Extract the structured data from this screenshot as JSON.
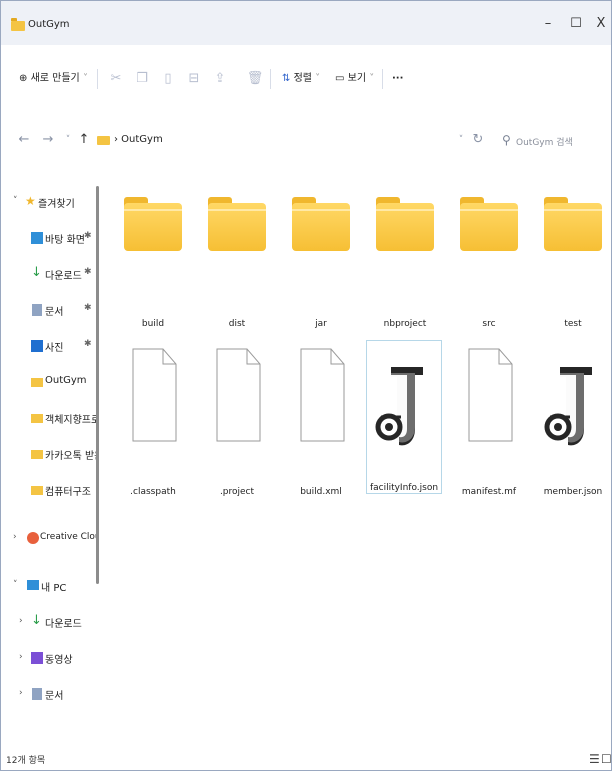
{
  "window": {
    "title": "OutGym",
    "minimize_glyph": "–",
    "maximize_glyph": "☐",
    "close_glyph": "X"
  },
  "toolbar": {
    "new_label": "새로 만들기",
    "sort_label": "정렬",
    "view_label": "보기",
    "more_label": "···",
    "icons": [
      "cut-icon",
      "copy-icon",
      "paste-icon",
      "rename-icon",
      "share-icon",
      "delete-icon"
    ]
  },
  "address": {
    "path": "› OutGym",
    "search_placeholder": "OutGym 검색"
  },
  "sidebar": {
    "items": [
      {
        "label": "즐겨찾기",
        "icon": "star-icon"
      },
      {
        "label": "바탕 화면",
        "icon": "desktop-icon"
      },
      {
        "label": "다운로드",
        "icon": "download-icon"
      },
      {
        "label": "문서",
        "icon": "document-icon"
      },
      {
        "label": "사진",
        "icon": "pictures-icon"
      },
      {
        "label": "OutGym",
        "icon": "folder-icon"
      },
      {
        "label": "객체지향프로그",
        "icon": "folder-icon"
      },
      {
        "label": "카카오톡 받은",
        "icon": "folder-icon"
      },
      {
        "label": "컴퓨터구조",
        "icon": "folder-icon"
      },
      {
        "label": "Creative Cloud F",
        "icon": "creative-cloud-icon"
      },
      {
        "label": "내 PC",
        "icon": "pc-icon"
      },
      {
        "label": "다운로드",
        "icon": "download-icon"
      },
      {
        "label": "동영상",
        "icon": "video-icon"
      },
      {
        "label": "문서",
        "icon": "document-icon"
      }
    ]
  },
  "files": [
    {
      "name": "build",
      "type": "folder"
    },
    {
      "name": "dist",
      "type": "folder"
    },
    {
      "name": "jar",
      "type": "folder"
    },
    {
      "name": "nbproject",
      "type": "folder"
    },
    {
      "name": "src",
      "type": "folder"
    },
    {
      "name": "test",
      "type": "folder"
    },
    {
      "name": ".classpath",
      "type": "file"
    },
    {
      "name": ".project",
      "type": "file"
    },
    {
      "name": "build.xml",
      "type": "file"
    },
    {
      "name": "facilityInfo.json",
      "type": "json",
      "selected": true
    },
    {
      "name": "manifest.mf",
      "type": "file"
    },
    {
      "name": "member.json",
      "type": "json"
    }
  ],
  "status": {
    "count": "12개 항목"
  },
  "colors": {
    "folder": "#f6bf34",
    "selection_border": "#b6d7e8",
    "titlebar": "#eef1f7"
  }
}
